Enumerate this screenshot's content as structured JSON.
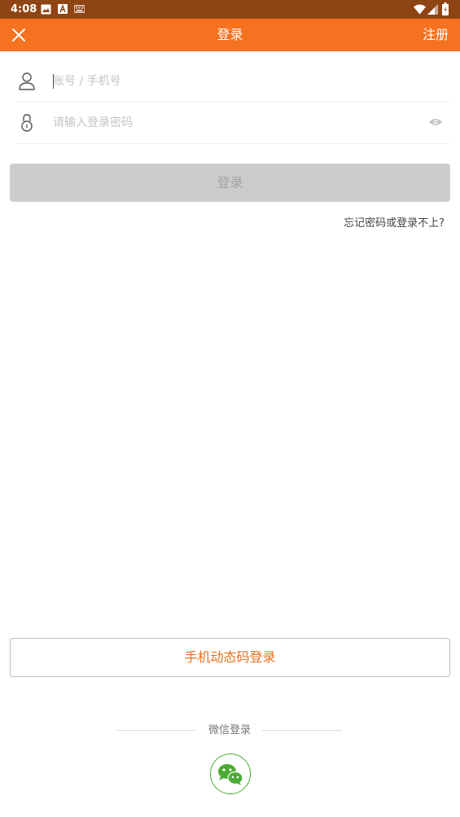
{
  "status_bar": {
    "time": "4:08",
    "icons": [
      "image-icon",
      "font-a-icon",
      "keyboard-icon",
      "wifi-icon",
      "signal-icon",
      "battery-icon"
    ]
  },
  "header": {
    "title": "登录",
    "close_icon": "close-icon",
    "register_label": "注册"
  },
  "form": {
    "account_placeholder": "账号 / 手机号",
    "password_placeholder": "请输入登录密码",
    "account_icon": "user-icon",
    "password_icon": "lock-icon",
    "visibility_icon": "eye-icon",
    "login_label": "登录",
    "forgot_label": "忘记密码或登录不上?"
  },
  "alt_login": {
    "sms_label": "手机动态码登录",
    "divider_label": "微信登录",
    "wechat_icon": "wechat-icon"
  },
  "colors": {
    "status_bar": "#8e4413",
    "brand_orange": "#f57220",
    "disabled_button": "#cccccc",
    "wechat_green": "#4cab35"
  }
}
